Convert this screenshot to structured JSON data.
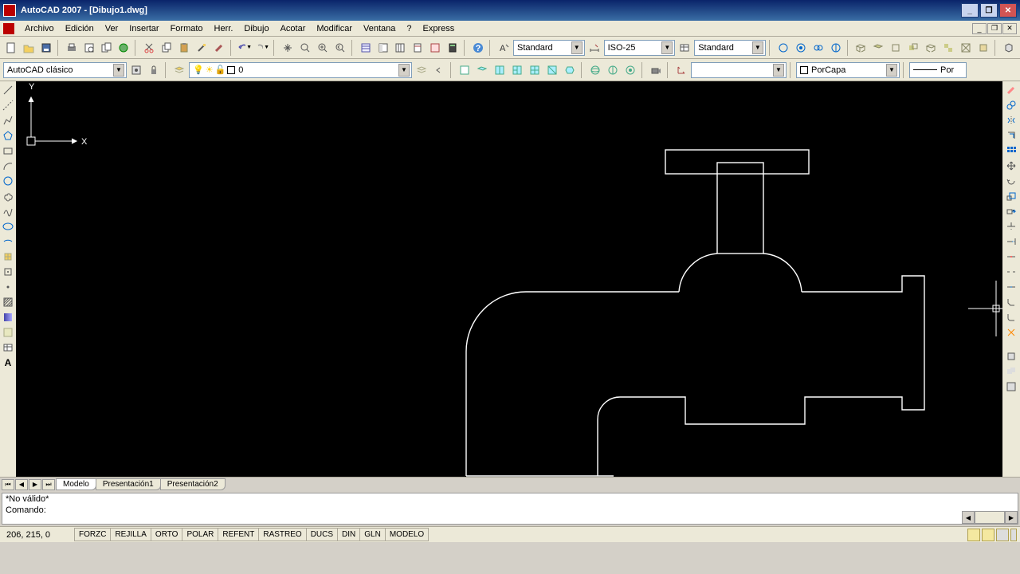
{
  "title": "AutoCAD 2007 - [Dibujo1.dwg]",
  "menu": [
    "Archivo",
    "Edición",
    "Ver",
    "Insertar",
    "Formato",
    "Herr.",
    "Dibujo",
    "Acotar",
    "Modificar",
    "Ventana",
    "?",
    "Express"
  ],
  "workspace_combo": "AutoCAD clásico",
  "layer_combo": "0",
  "text_style": "Standard",
  "dim_style": "ISO-25",
  "table_style": "Standard",
  "color_combo": "PorCapa",
  "linetype_combo": "Por",
  "tabs": {
    "active": "Modelo",
    "others": [
      "Presentación1",
      "Presentación2"
    ]
  },
  "cmd": {
    "line1": "*No válido*",
    "line2": "Comando:"
  },
  "status": {
    "coords": "206, 215, 0",
    "buttons": [
      "FORZC",
      "REJILLA",
      "ORTO",
      "POLAR",
      "REFENT",
      "RASTREO",
      "DUCS",
      "DIN",
      "GLN",
      "MODELO"
    ]
  },
  "ucs": {
    "x": "X",
    "y": "Y"
  }
}
